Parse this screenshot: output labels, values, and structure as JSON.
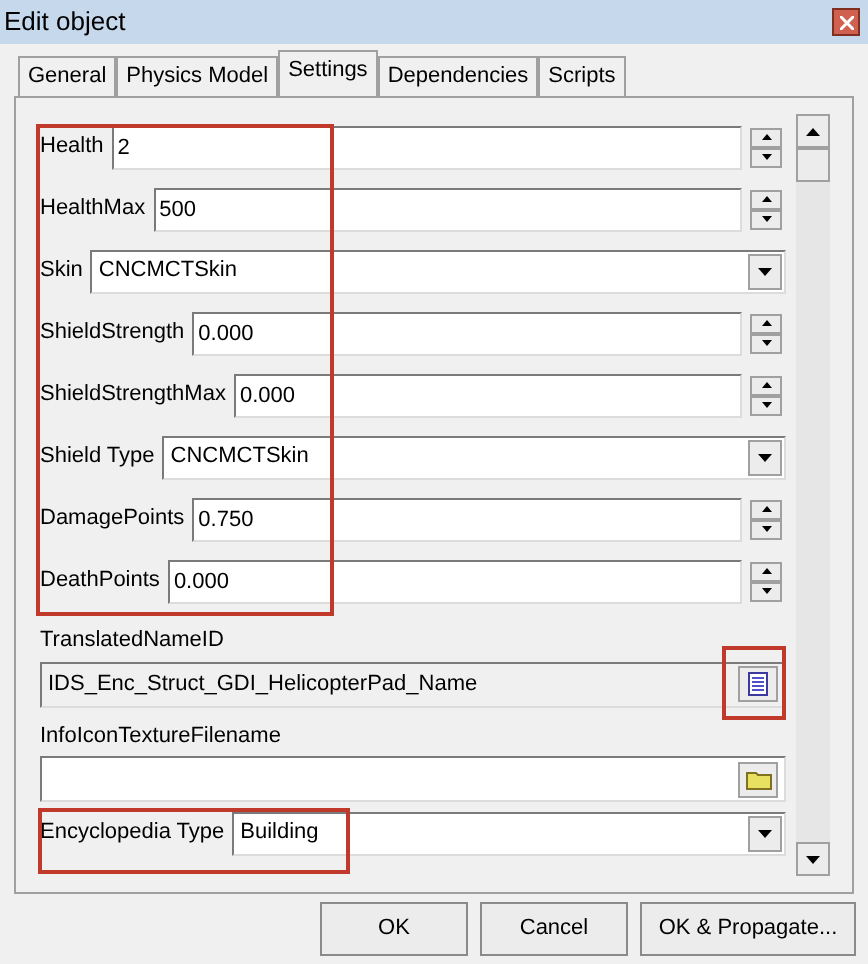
{
  "window": {
    "title": "Edit object"
  },
  "tabs": [
    {
      "label": "General",
      "selected": false
    },
    {
      "label": "Physics Model",
      "selected": false
    },
    {
      "label": "Settings",
      "selected": true
    },
    {
      "label": "Dependencies",
      "selected": false
    },
    {
      "label": "Scripts",
      "selected": false
    }
  ],
  "fields": [
    {
      "kind": "spin",
      "label": "Health",
      "value": "2"
    },
    {
      "kind": "spin",
      "label": "HealthMax",
      "value": "500"
    },
    {
      "kind": "combo",
      "label": "Skin",
      "value": "CNCMCTSkin"
    },
    {
      "kind": "spin",
      "label": "ShieldStrength",
      "value": "0.000"
    },
    {
      "kind": "spin",
      "label": "ShieldStrengthMax",
      "value": "0.000"
    },
    {
      "kind": "combo",
      "label": "Shield Type",
      "value": "CNCMCTSkin"
    },
    {
      "kind": "spin",
      "label": "DamagePoints",
      "value": "0.750"
    },
    {
      "kind": "spin",
      "label": "DeathPoints",
      "value": "0.000"
    },
    {
      "kind": "picker",
      "label": "TranslatedNameID",
      "value": "IDS_Enc_Struct_GDI_HelicopterPad_Name",
      "disabled": true
    },
    {
      "kind": "file",
      "label": "InfoIconTextureFilename",
      "disabled": false
    },
    {
      "kind": "combo",
      "label": "Encyclopedia Type",
      "value": "Building"
    }
  ],
  "buttons": [
    "OK",
    "Cancel",
    "OK & Propagate..."
  ]
}
